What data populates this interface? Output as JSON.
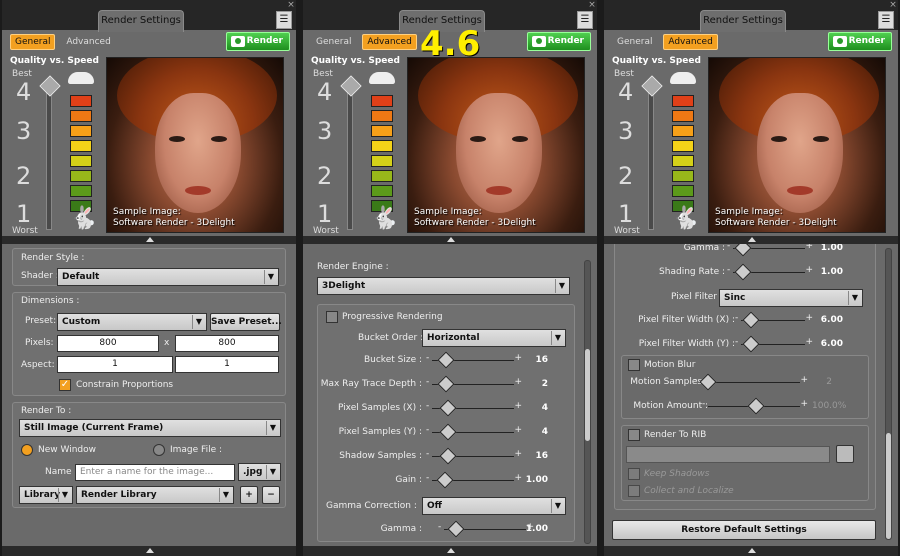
{
  "version_label": "4.6",
  "common": {
    "title": "Render Settings",
    "tab_general": "General",
    "tab_advanced": "Advanced",
    "render_button": "Render",
    "quality_label": "Quality vs. Speed",
    "best": "Best",
    "worst": "Worst",
    "levels": [
      "4",
      "3",
      "2",
      "1"
    ],
    "caption_line1": "Sample Image:",
    "caption_line2": "Software Render - 3Delight",
    "quality_colors": [
      "#e04018",
      "#ee7814",
      "#f6a018",
      "#f4d218",
      "#d4d018",
      "#98b81a",
      "#5c9a1a",
      "#3a7a18"
    ],
    "accent_color": "#f3a020"
  },
  "panel1": {
    "active_tab": "General",
    "render_style": {
      "group_label": "Render Style :",
      "shader_label": "Shader :",
      "shader_value": "Default"
    },
    "dimensions": {
      "group_label": "Dimensions :",
      "preset_label": "Preset:",
      "preset_value": "Custom",
      "save_preset": "Save Preset...",
      "pixels_label": "Pixels:",
      "width": "800",
      "times": "x",
      "height": "800",
      "aspect_label": "Aspect:",
      "aspect_w": "1",
      "aspect_h": "1",
      "constrain": "Constrain Proportions"
    },
    "render_to": {
      "group_label": "Render To :",
      "target": "Still Image (Current Frame)",
      "new_window": "New Window",
      "image_file": "Image File :",
      "name_label": "Name :",
      "name_placeholder": "Enter a name for the image...",
      "ext": ".jpg",
      "library": "Library",
      "render_library": "Render Library",
      "plus": "+",
      "minus": "−"
    }
  },
  "panel2": {
    "active_tab": "Advanced",
    "engine_label": "Render Engine :",
    "engine_value": "3Delight",
    "progressive": "Progressive Rendering",
    "bucket_order_label": "Bucket Order :",
    "bucket_order_value": "Horizontal",
    "sliders": [
      {
        "label": "Bucket Size :",
        "value": "16",
        "pos": 0.1
      },
      {
        "label": "Max Ray Trace Depth :",
        "value": "2",
        "pos": 0.1
      },
      {
        "label": "Pixel Samples (X) :",
        "value": "4",
        "pos": 0.12
      },
      {
        "label": "Pixel Samples (Y) :",
        "value": "4",
        "pos": 0.12
      },
      {
        "label": "Shadow Samples :",
        "value": "16",
        "pos": 0.12
      },
      {
        "label": "Gain :",
        "value": "1.00",
        "pos": 0.08
      }
    ],
    "gamma_correction_label": "Gamma Correction :",
    "gamma_correction_value": "Off",
    "gamma": {
      "label": "Gamma :",
      "value": "1.00",
      "pos": 0.08
    }
  },
  "panel3": {
    "active_tab": "Advanced",
    "gamma": {
      "label": "Gamma :",
      "value": "1.00",
      "pos": 0.08
    },
    "shading_rate": {
      "label": "Shading Rate :",
      "value": "1.00",
      "pos": 0.08
    },
    "pixel_filter_label": "Pixel Filter :",
    "pixel_filter_value": "Sinc",
    "filter_w": {
      "label": "Pixel Filter Width (X) :",
      "value": "6.00",
      "pos": 0.08
    },
    "filter_h": {
      "label": "Pixel Filter Width (Y) :",
      "value": "6.00",
      "pos": 0.08
    },
    "motion_blur": "Motion Blur",
    "motion_samples": {
      "label": "Motion Samples :",
      "value": "2",
      "pos": 0.05
    },
    "motion_amount": {
      "label": "Motion Amount :",
      "value": "100.0%",
      "pos": 0.5
    },
    "render_to_rib": "Render To RIB",
    "keep_shadows": "Keep Shadows",
    "collect_localize": "Collect and Localize",
    "restore": "Restore Default Settings"
  }
}
